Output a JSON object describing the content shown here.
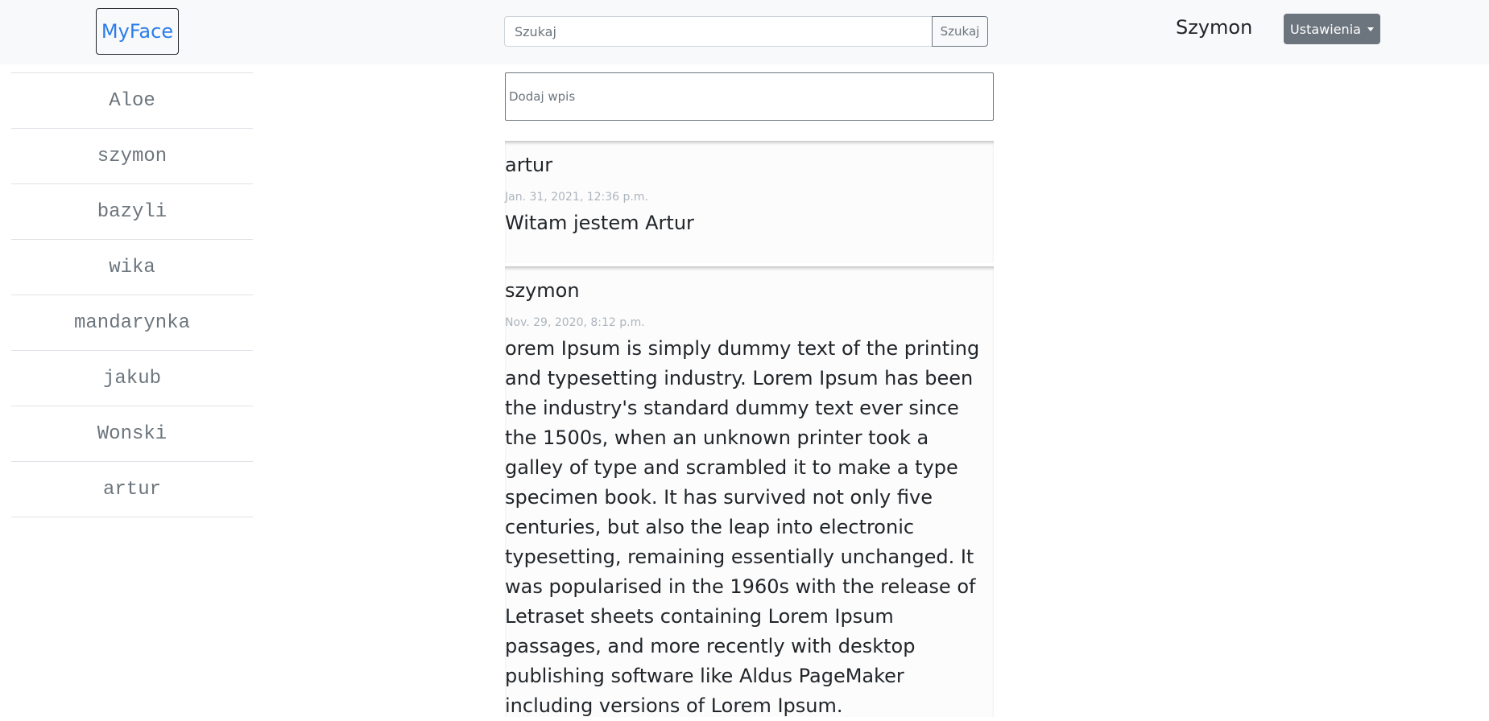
{
  "header": {
    "brand": "MyFace",
    "search_placeholder": "Szukaj",
    "search_button": "Szukaj",
    "username": "Szymon",
    "settings_button": "Ustawienia"
  },
  "sidebar": {
    "friends": [
      "Aloe",
      "szymon",
      "bazyli",
      "wika",
      "mandarynka",
      "jakub",
      "Wonski",
      "artur"
    ]
  },
  "feed": {
    "new_post_placeholder": "Dodaj wpis",
    "posts": [
      {
        "author": "artur",
        "date": "Jan. 31, 2021, 12:36 p.m.",
        "body": "Witam jestem Artur"
      },
      {
        "author": "szymon",
        "date": "Nov. 29, 2020, 8:12 p.m.",
        "body": "orem Ipsum is simply dummy text of the printing and typesetting industry. Lorem Ipsum has been the industry's standard dummy text ever since the 1500s, when an unknown printer took a galley of type and scrambled it to make a type specimen book. It has survived not only five centuries, but also the leap into electronic typesetting, remaining essentially unchanged. It was popularised in the 1960s with the release of Letraset sheets containing Lorem Ipsum passages, and more recently with desktop publishing software like Aldus PageMaker including versions of Lorem Ipsum."
      }
    ]
  }
}
